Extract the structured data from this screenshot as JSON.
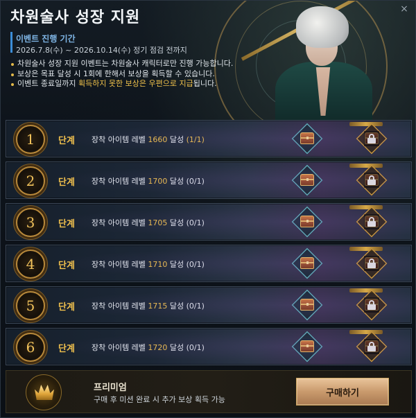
{
  "window": {
    "close_label": "×"
  },
  "header": {
    "title": "차원술사 성장 지원",
    "period_title": "이벤트 진행 기간",
    "period_value": "2026.7.8(수) ~ 2026.10.14(수) 정기 점검 전까지",
    "notes": [
      "차원술사 성장 지원 이벤트는 차원술사 캐릭터로만 진행 가능합니다.",
      "보상은 목표 달성 시 1회에 한해서 보상을 획득할 수 있습니다."
    ],
    "note3_prefix": "이벤트 종료일까지 ",
    "note3_highlight": "획득하지 못한 보상은 우편으로 지급",
    "note3_suffix": "됩니다."
  },
  "stages": [
    {
      "number": "1",
      "label": "단계",
      "desc_prefix": "장착 아이템 레벨 ",
      "level": "1660",
      "desc_suffix": " 달성 ",
      "progress": "(1/1)"
    },
    {
      "number": "2",
      "label": "단계",
      "desc_prefix": "장착 아이템 레벨 ",
      "level": "1700",
      "desc_suffix": " 달성 ",
      "progress": "(0/1)"
    },
    {
      "number": "3",
      "label": "단계",
      "desc_prefix": "장착 아이템 레벨 ",
      "level": "1705",
      "desc_suffix": " 달성 ",
      "progress": "(0/1)"
    },
    {
      "number": "4",
      "label": "단계",
      "desc_prefix": "장착 아이템 레벨 ",
      "level": "1710",
      "desc_suffix": " 달성 ",
      "progress": "(0/1)"
    },
    {
      "number": "5",
      "label": "단계",
      "desc_prefix": "장착 아이템 레벨 ",
      "level": "1715",
      "desc_suffix": " 달성 ",
      "progress": "(0/1)"
    },
    {
      "number": "6",
      "label": "단계",
      "desc_prefix": "장착 아이템 레벨 ",
      "level": "1720",
      "desc_suffix": " 달성 ",
      "progress": "(0/1)"
    }
  ],
  "reward_icons": {
    "basic": "treasure-chest-icon",
    "premium": "locked-chest-icon"
  },
  "premium": {
    "title": "프리미엄",
    "description": "구매 후 미션 완료 시 추가 보상 획득 가능",
    "buy_label": "구매하기"
  },
  "colors": {
    "accent_gold": "#f1c14c",
    "accent_blue": "#3c8ed8",
    "highlight": "#f0c24b"
  }
}
